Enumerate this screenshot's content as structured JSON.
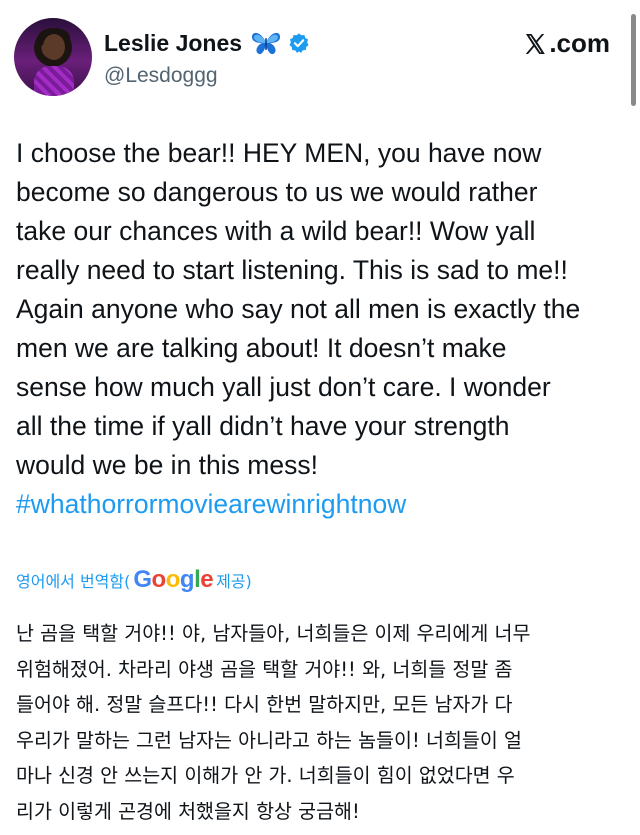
{
  "header": {
    "display_name": "Leslie Jones",
    "handle": "@Lesdoggg",
    "brand": ".com",
    "badges": [
      "butterfly-icon",
      "verified-icon"
    ],
    "avatar_icon": "avatar"
  },
  "tweet": {
    "lines": [
      "I choose the bear!! HEY MEN, you have now",
      "become so dangerous to us we would rather",
      "take our chances with a wild bear!! Wow yall",
      "really need to start listening. This is sad to me!!",
      "Again anyone who say not all men is exactly the",
      "men we are talking about! It doesn’t make",
      "sense how much yall just don’t care. I wonder",
      "all the time if yall didn’t have your strength",
      "would we be in this mess!"
    ],
    "hashtag": "#whathorrormoviearewinrightnow"
  },
  "translation": {
    "label_prefix": "영어에서 번역함(",
    "google_letters": [
      "G",
      "o",
      "o",
      "g",
      "l",
      "e"
    ],
    "label_suffix": " 제공)",
    "lines": [
      "난 곰을 택할 거야!! 야, 남자들아, 너희들은 이제 우리에게 너무",
      "위험해졌어. 차라리 야생 곰을 택할 거야!! 와, 너희들 정말 좀",
      "들어야 해. 정말 슬프다!! 다시 한번 말하지만, 모든 남자가 다",
      "우리가 말하는 그런 남자는 아니라고 하는 놈들이! 너희들이 얼",
      "마나 신경 안 쓰는지 이해가 안 가. 너희들이 힘이 없었다면 우",
      "리가 이렇게 곤경에 처했을지 항상 궁금해!"
    ]
  },
  "colors": {
    "link": "#1d9bf0",
    "text": "#0f1419",
    "muted": "#536471",
    "verified": "#1d9bf0"
  }
}
